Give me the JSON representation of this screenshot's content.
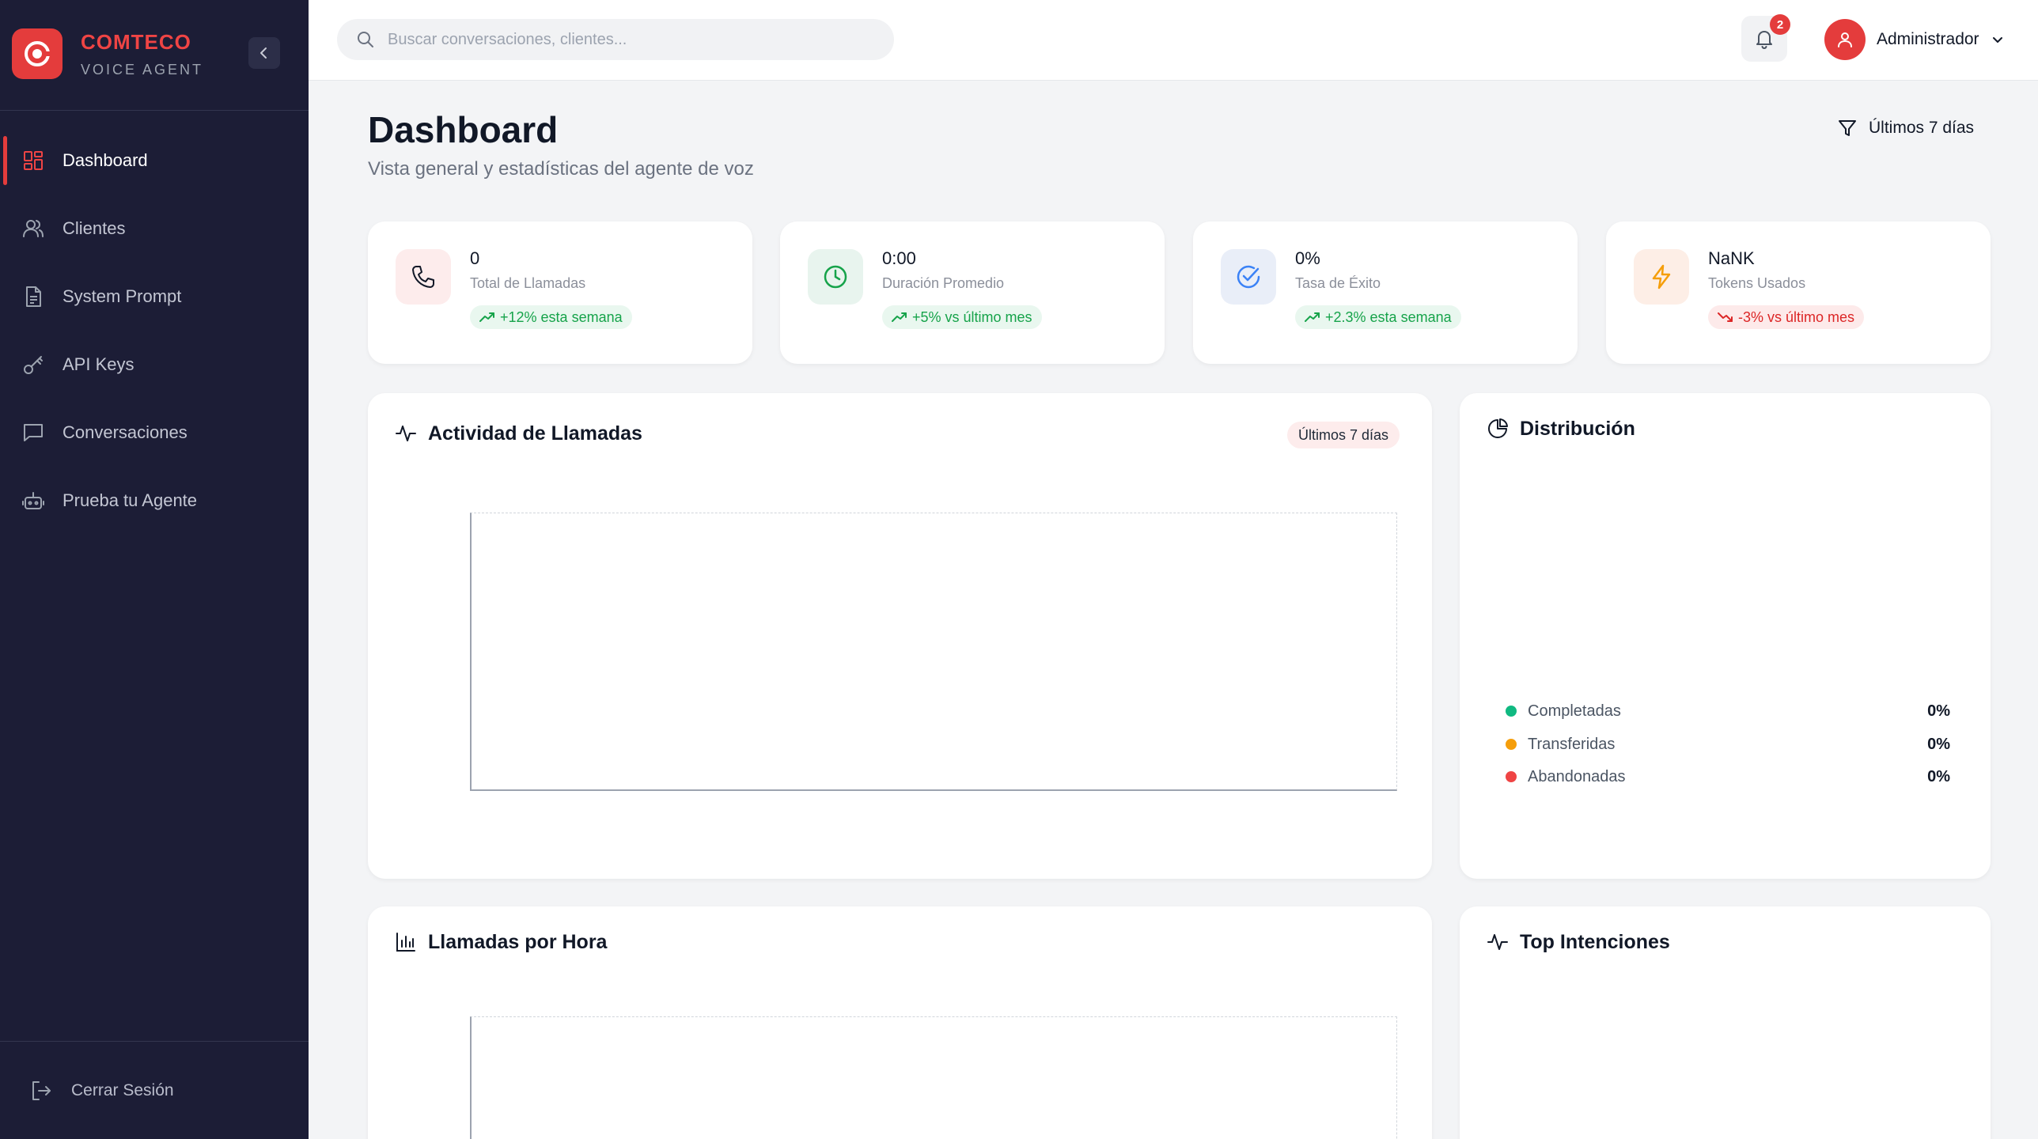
{
  "brand": {
    "name": "COMTECO",
    "subtitle": "VOICE AGENT"
  },
  "sidebar": {
    "items": [
      {
        "label": "Dashboard",
        "icon": "grid-icon",
        "active": true
      },
      {
        "label": "Clientes",
        "icon": "users-icon",
        "active": false
      },
      {
        "label": "System Prompt",
        "icon": "document-icon",
        "active": false
      },
      {
        "label": "API Keys",
        "icon": "key-icon",
        "active": false
      },
      {
        "label": "Conversaciones",
        "icon": "message-icon",
        "active": false
      },
      {
        "label": "Prueba tu Agente",
        "icon": "bot-icon",
        "active": false
      }
    ],
    "logout_label": "Cerrar Sesión"
  },
  "header": {
    "search_placeholder": "Buscar conversaciones, clientes...",
    "notifications_count": "2",
    "user_name": "Administrador"
  },
  "page": {
    "title": "Dashboard",
    "subtitle": "Vista general y estadísticas del agente de voz",
    "filter_label": "Últimos 7 días"
  },
  "stats": [
    {
      "value": "0",
      "label": "Total de Llamadas",
      "trend": "+12% esta semana",
      "direction": "up",
      "icon": "phone-icon",
      "color": "#ef4444",
      "bg": "#fdecec"
    },
    {
      "value": "0:00",
      "label": "Duración Promedio",
      "trend": "+5% vs último mes",
      "direction": "up",
      "icon": "clock-icon",
      "color": "#16a34a",
      "bg": "#e8f4ee"
    },
    {
      "value": "0%",
      "label": "Tasa de Éxito",
      "trend": "+2.3% esta semana",
      "direction": "up",
      "icon": "check-circle-icon",
      "color": "#3b82f6",
      "bg": "#e9eef8"
    },
    {
      "value": "NaNK",
      "label": "Tokens Usados",
      "trend": "-3% vs último mes",
      "direction": "down",
      "icon": "bolt-icon",
      "color": "#f59e0b",
      "bg": "#fdeee6"
    }
  ],
  "activity": {
    "title": "Actividad de Llamadas",
    "period": "Últimos 7 días"
  },
  "distribution": {
    "title": "Distribución",
    "items": [
      {
        "label": "Completadas",
        "value": "0%",
        "color": "#10b981"
      },
      {
        "label": "Transferidas",
        "value": "0%",
        "color": "#f59e0b"
      },
      {
        "label": "Abandonadas",
        "value": "0%",
        "color": "#ef4444"
      }
    ]
  },
  "hourly": {
    "title": "Llamadas por Hora"
  },
  "intents": {
    "title": "Top Intenciones"
  },
  "colors": {
    "accent": "#e43c3c",
    "sidebar_bg": "#1c1d36",
    "page_bg": "#f3f4f6"
  }
}
